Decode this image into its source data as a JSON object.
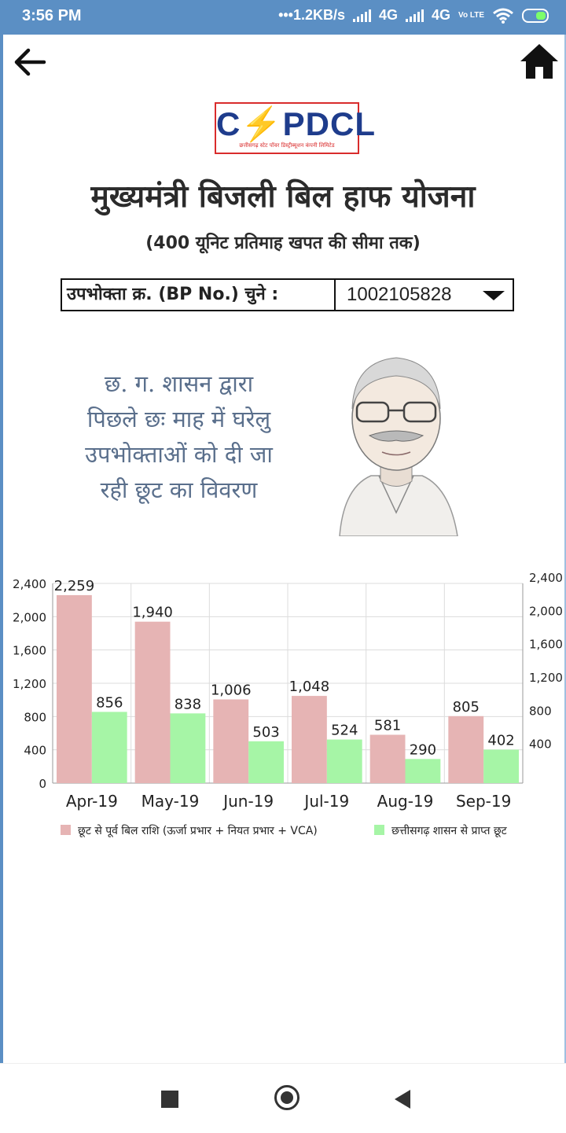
{
  "status": {
    "time": "3:56 PM",
    "net_speed": "•••1.2KB/s",
    "net1": "4G",
    "net2": "4G",
    "volte": "Vo LTE"
  },
  "logo": {
    "text_a": "C",
    "text_b": "PDCL",
    "subtitle": "छत्तीसगढ़ स्टेट पॉवर डिस्ट्रीब्यूशन कंपनी लिमिटेड"
  },
  "title": "मुख्यमंत्री बिजली बिल हाफ योजना",
  "subtitle": "(400 यूनिट प्रतिमाह खपत की सीमा तक)",
  "bp": {
    "label": "उपभोक्ता क्र. (BP No.) चुने :",
    "value": "1002105828"
  },
  "scheme_text": [
    "छ. ग. शासन द्वारा",
    "पिछले छः माह में घरेलु",
    "उपभोक्ताओं को दी जा",
    "रही छूट का विवरण"
  ],
  "colors": {
    "series1": "#e6b4b4",
    "series2": "#a6f5a6",
    "accent": "#5b8fc4"
  },
  "chart_data": {
    "type": "bar",
    "categories": [
      "Apr-19",
      "May-19",
      "Jun-19",
      "Jul-19",
      "Aug-19",
      "Sep-19"
    ],
    "series": [
      {
        "name": "छूट से पूर्व बिल राशि (ऊर्जा प्रभार + नियत प्रभार + VCA)",
        "values": [
          2259,
          1940,
          1006,
          1048,
          581,
          805
        ],
        "labels": [
          "2,259",
          "1,940",
          "1,006",
          "1,048",
          "581",
          "805"
        ]
      },
      {
        "name": "छत्तीसगढ़ शासन से प्राप्त छूट",
        "values": [
          856,
          838,
          503,
          524,
          290,
          402
        ],
        "labels": [
          "856",
          "838",
          "503",
          "524",
          "290",
          "402"
        ]
      }
    ],
    "y_ticks_left": [
      "0",
      "400",
      "800",
      "1,200",
      "1,600",
      "2,000",
      "2,400"
    ],
    "y_ticks_right": [
      "400",
      "800",
      "1,200",
      "1,600",
      "2,000",
      "2,400"
    ],
    "ylim": [
      0,
      2400
    ],
    "grid": true,
    "legend": "bottom",
    "title": "",
    "xlabel": "",
    "ylabel": ""
  }
}
